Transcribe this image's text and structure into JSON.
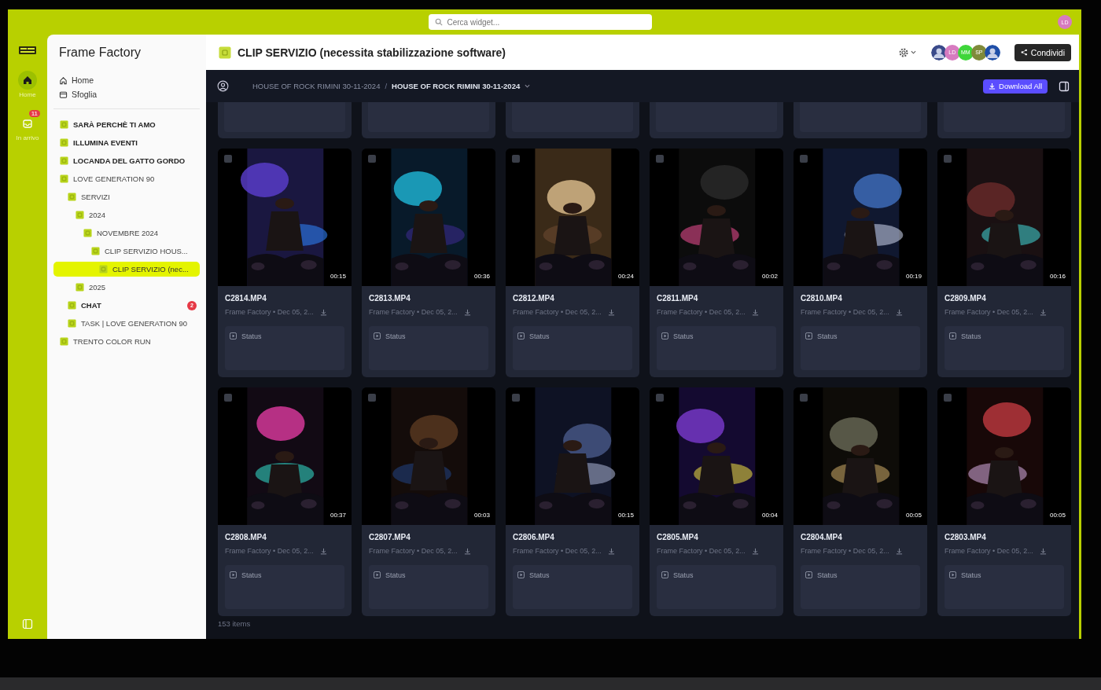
{
  "search": {
    "placeholder": "Cerca widget..."
  },
  "user_avatar": "LD",
  "rail": [
    {
      "label": "Home",
      "kind": "home",
      "selected": true
    },
    {
      "label": "In arrivo",
      "kind": "inbox",
      "selected": false,
      "badge": "11"
    }
  ],
  "sidebar": {
    "title": "Frame Factory",
    "nav": [
      {
        "label": "Home",
        "kind": "home"
      },
      {
        "label": "Sfoglia",
        "kind": "browse"
      }
    ],
    "tree": [
      {
        "label": "SARÀ PERCHÈ TI AMO",
        "bold": true,
        "selected": false
      },
      {
        "label": "ILLUMINA EVENTI",
        "bold": true,
        "selected": false
      },
      {
        "label": "LOCANDA DEL GATTO GORDO",
        "bold": true,
        "selected": false
      },
      {
        "label": "LOVE GENERATION 90",
        "bold": false,
        "selected": false,
        "children": [
          {
            "label": "SERVIZI",
            "bold": false,
            "selected": false,
            "children": [
              {
                "label": "2024",
                "bold": false,
                "selected": false,
                "children": [
                  {
                    "label": "NOVEMBRE 2024",
                    "bold": false,
                    "selected": false,
                    "children": [
                      {
                        "label": "CLIP SERVIZIO HOUS...",
                        "bold": false,
                        "selected": false,
                        "children": [
                          {
                            "label": "CLIP SERVIZIO (nec...",
                            "bold": false,
                            "selected": true
                          }
                        ]
                      }
                    ]
                  }
                ]
              },
              {
                "label": "2025",
                "bold": false,
                "selected": false
              }
            ]
          },
          {
            "label": "CHAT",
            "bold": true,
            "selected": false,
            "badge": "2"
          },
          {
            "label": "TASK | LOVE GENERATION 90",
            "bold": false,
            "selected": false
          }
        ]
      },
      {
        "label": "TRENTO COLOR RUN",
        "bold": false,
        "selected": false
      }
    ]
  },
  "header": {
    "title": "CLIP SERVIZIO (necessita stabilizzazione software)",
    "avatars": [
      {
        "kind": "picture",
        "color": "#3a4a8a"
      },
      {
        "kind": "initials",
        "text": "LD",
        "color": "#d77bc0"
      },
      {
        "kind": "initials",
        "text": "MM",
        "color": "#3fd63a"
      },
      {
        "kind": "initials",
        "text": "SP",
        "color": "#7f8a3a"
      },
      {
        "kind": "picture",
        "color": "#1f4fa8"
      }
    ],
    "share_button": "Condividi"
  },
  "toolbar": {
    "breadcrumb_separator": "/",
    "breadcrumb": [
      {
        "label": "HOUSE OF ROCK RIMINI 30-11-2024",
        "selected": false
      },
      {
        "label": "HOUSE OF ROCK RIMINI 30-11-2024",
        "selected": true
      }
    ],
    "download_button": "Download All"
  },
  "files": [
    {
      "checked": false,
      "name": "C2814.MP4",
      "duration": "00:15",
      "meta": "Frame Factory • Dec 05, 2...",
      "status": "Status",
      "kind": "picture"
    },
    {
      "checked": false,
      "name": "C2813.MP4",
      "duration": "00:36",
      "meta": "Frame Factory • Dec 05, 2...",
      "status": "Status",
      "kind": "picture"
    },
    {
      "checked": false,
      "name": "C2812.MP4",
      "duration": "00:24",
      "meta": "Frame Factory • Dec 05, 2...",
      "status": "Status",
      "kind": "picture"
    },
    {
      "checked": false,
      "name": "C2811.MP4",
      "duration": "00:02",
      "meta": "Frame Factory • Dec 05, 2...",
      "status": "Status",
      "kind": "picture"
    },
    {
      "checked": false,
      "name": "C2810.MP4",
      "duration": "00:19",
      "meta": "Frame Factory • Dec 05, 2...",
      "status": "Status",
      "kind": "picture"
    },
    {
      "checked": false,
      "name": "C2809.MP4",
      "duration": "00:16",
      "meta": "Frame Factory • Dec 05, 2...",
      "status": "Status",
      "kind": "picture"
    },
    {
      "checked": false,
      "name": "C2808.MP4",
      "duration": "00:37",
      "meta": "Frame Factory • Dec 05, 2...",
      "status": "Status",
      "kind": "picture"
    },
    {
      "checked": false,
      "name": "C2807.MP4",
      "duration": "00:03",
      "meta": "Frame Factory • Dec 05, 2...",
      "status": "Status",
      "kind": "picture"
    },
    {
      "checked": false,
      "name": "C2806.MP4",
      "duration": "00:15",
      "meta": "Frame Factory • Dec 05, 2...",
      "status": "Status",
      "kind": "picture"
    },
    {
      "checked": false,
      "name": "C2805.MP4",
      "duration": "00:04",
      "meta": "Frame Factory • Dec 05, 2...",
      "status": "Status",
      "kind": "picture"
    },
    {
      "checked": false,
      "name": "C2804.MP4",
      "duration": "00:05",
      "meta": "Frame Factory • Dec 05, 2...",
      "status": "Status",
      "kind": "picture"
    },
    {
      "checked": false,
      "name": "C2803.MP4",
      "duration": "00:05",
      "meta": "Frame Factory • Dec 05, 2...",
      "status": "Status",
      "kind": "picture"
    }
  ],
  "footer": "153 items"
}
